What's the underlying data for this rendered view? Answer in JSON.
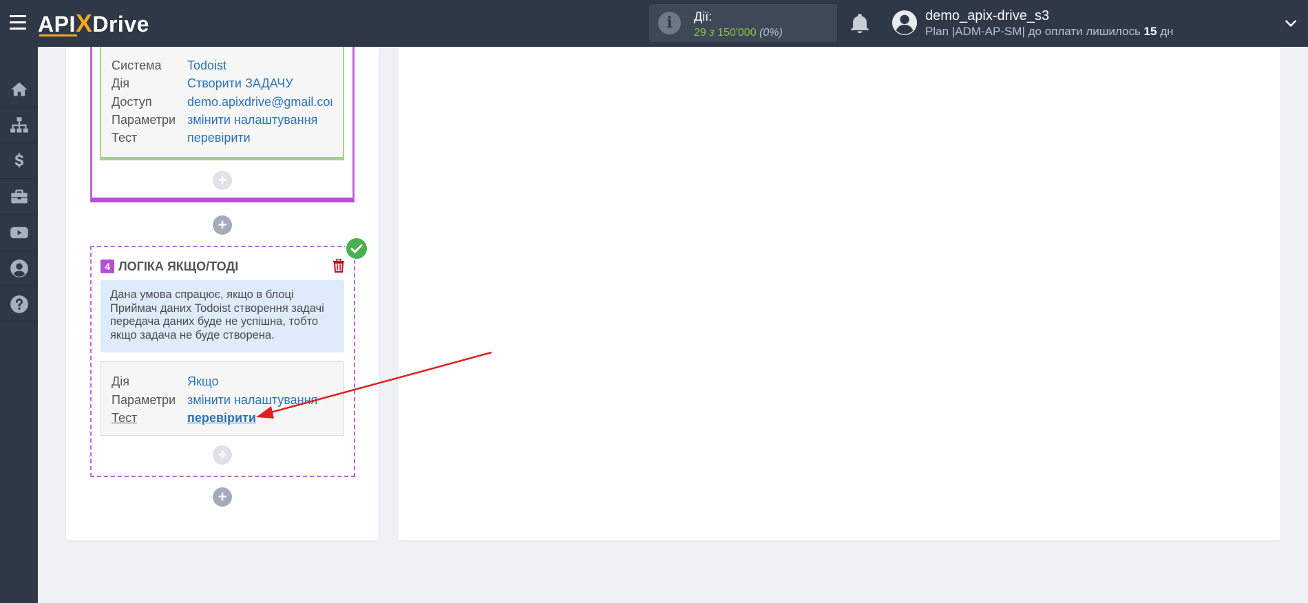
{
  "header": {
    "logo": {
      "api": "API",
      "x": "X",
      "drive": "Drive"
    },
    "actions": {
      "title": "Дії:",
      "used": "29",
      "of": "з",
      "limit": "150'000",
      "percent": "(0%)"
    },
    "user": {
      "name": "demo_apix-drive_s3",
      "plan_prefix": "Plan |ADM-AP-SM| до оплати лишилось ",
      "days": "15",
      "days_suffix": " дн"
    }
  },
  "sidebar": {
    "items": [
      {
        "icon": "home-icon"
      },
      {
        "icon": "sitemap-icon"
      },
      {
        "icon": "dollar-icon"
      },
      {
        "icon": "briefcase-icon"
      },
      {
        "icon": "youtube-icon"
      },
      {
        "icon": "user-circle-icon"
      },
      {
        "icon": "question-circle-icon"
      }
    ]
  },
  "block3": {
    "rows": [
      {
        "key": "Система",
        "value": "Todoist"
      },
      {
        "key": "Дія",
        "value": "Створити ЗАДАЧУ"
      },
      {
        "key": "Доступ",
        "value": "demo.apixdrive@gmail.cor"
      },
      {
        "key": "Параметри",
        "value": "змінити налаштування"
      },
      {
        "key": "Тест",
        "value": "перевірити"
      }
    ]
  },
  "block4": {
    "number": "4",
    "title": "ЛОГІКА ЯКЩО/ТОДІ",
    "description": "Дана умова спрацює, якщо в блоці Приймач даних Todoist створення задачі передача даних буде не успішна, тобто якщо задача не буде створена.",
    "rows": [
      {
        "key": "Дія",
        "value": "Якщо"
      },
      {
        "key": "Параметри",
        "value": "змінити налаштування"
      },
      {
        "key": "Тест",
        "value": "перевірити"
      }
    ]
  },
  "plus_symbol": "+",
  "colors": {
    "header_bg": "#2e3847",
    "accent_orange": "#f7a823",
    "accent_purple": "#b44fd6",
    "success_green": "#4caf50",
    "link_blue": "#2a72b5",
    "annotation_red": "#e02020"
  }
}
